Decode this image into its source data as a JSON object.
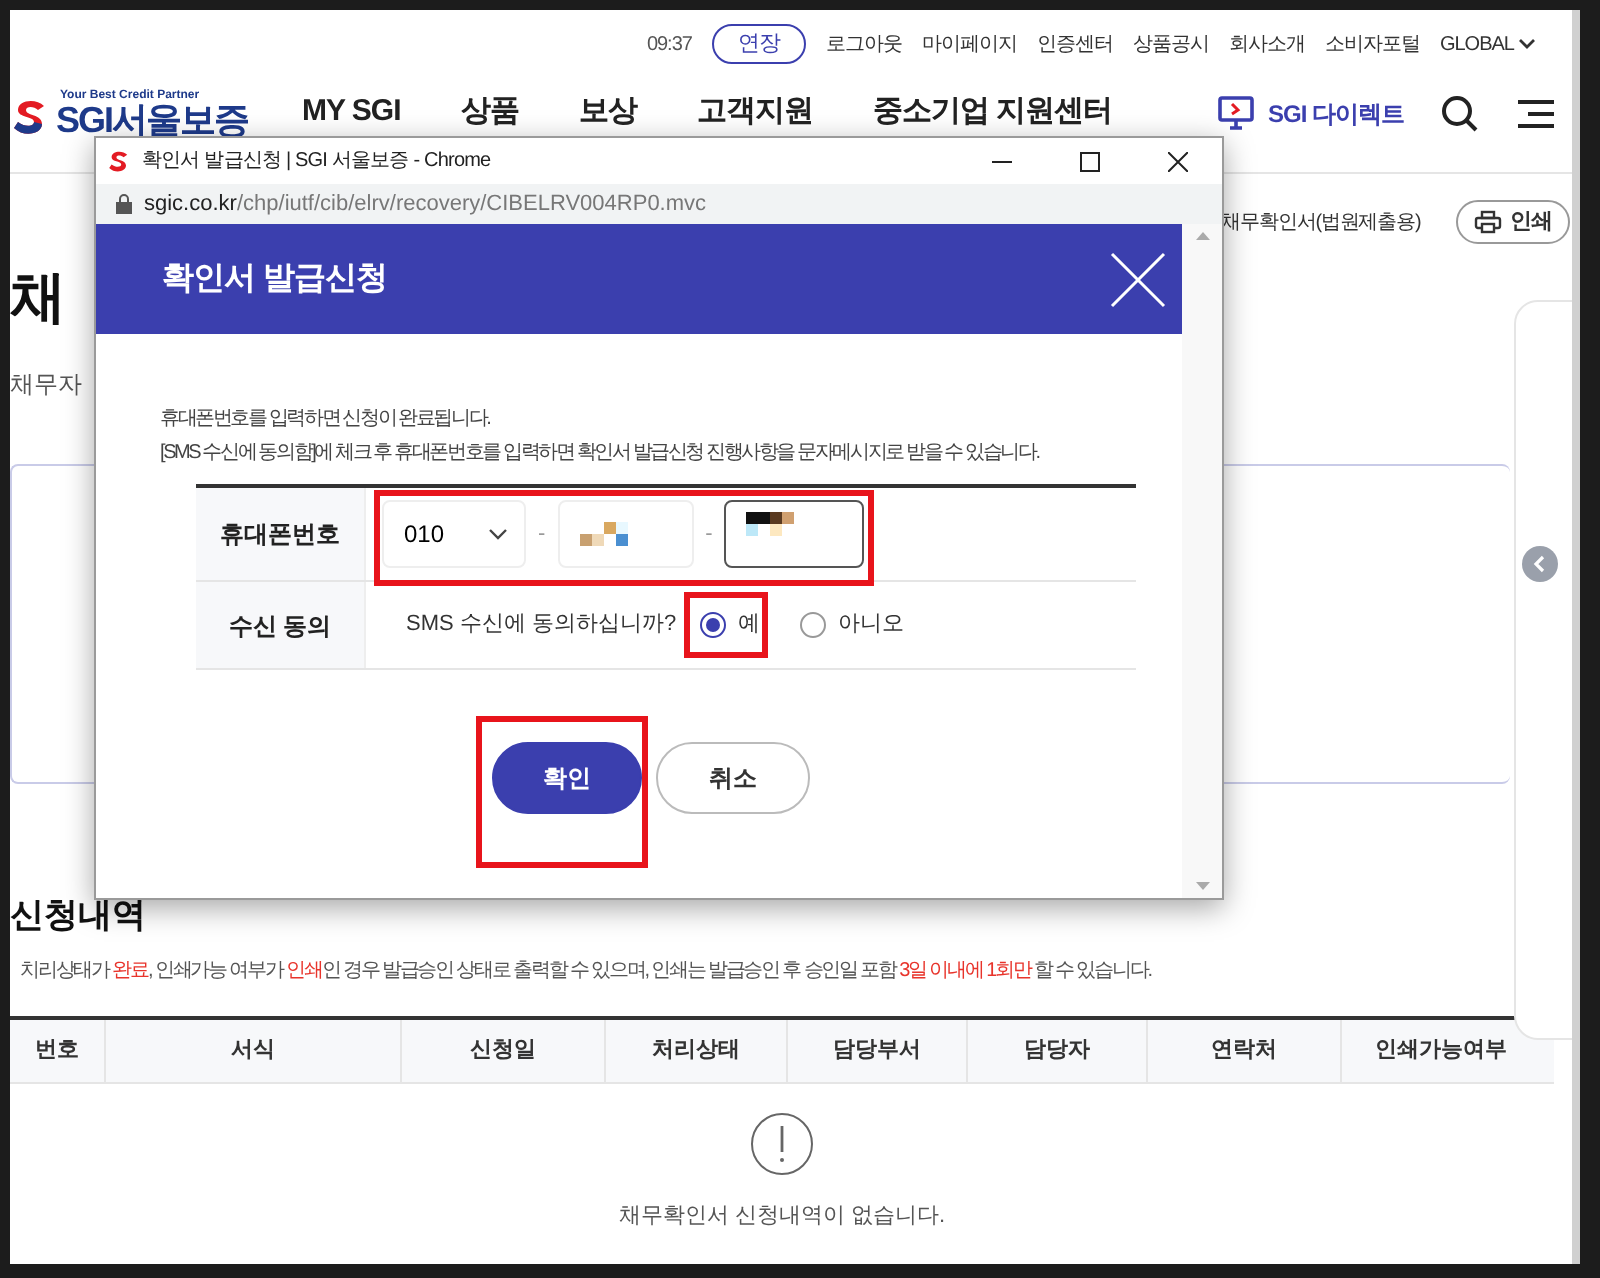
{
  "top_bar": {
    "time": "09:37",
    "extend_button": "연장",
    "links": [
      "로그아웃",
      "마이페이지",
      "인증센터",
      "상품공시",
      "회사소개",
      "소비자포털"
    ],
    "language": "GLOBAL"
  },
  "header": {
    "logo_tagline": "Your Best Credit Partner",
    "logo_text": "SGI서울보증",
    "nav": [
      "MY SGI",
      "상품",
      "보상",
      "고객지원",
      "중소기업 지원센터"
    ],
    "direct_link": "SGI 다이렉트"
  },
  "breadcrumb": [
    "채무확인서(법원제출용)"
  ],
  "print_button": "인쇄",
  "page_title": "채",
  "page_subtitle": "채무자",
  "history": {
    "title": "신청내역",
    "note_parts": [
      {
        "text": "치리상태가 ",
        "highlight": false
      },
      {
        "text": "완료",
        "highlight": true
      },
      {
        "text": ", 인쇄가능 여부가 ",
        "highlight": false
      },
      {
        "text": "인쇄",
        "highlight": true
      },
      {
        "text": "인 경우 발급승인 상태로 출력할 수 있으며, 인쇄는 발급승인 후 승인일 포함 ",
        "highlight": false
      },
      {
        "text": "3일 이내에 1회만",
        "highlight": true
      },
      {
        "text": " 할 수 있습니다.",
        "highlight": false
      }
    ],
    "columns": [
      "번호",
      "서식",
      "신청일",
      "처리상태",
      "담당부서",
      "담당자",
      "연락처",
      "인쇄가능여부"
    ],
    "empty_message": "채무확인서 신청내역이 없습니다."
  },
  "popup": {
    "window_title": "확인서 발급신청 | SGI 서울보증 - Chrome",
    "url_domain": "sgic.co.kr",
    "url_path": "/chp/iutf/cib/elrv/recovery/CIBELRV004RP0.mvc",
    "title": "확인서 발급신청",
    "notes": [
      "휴대폰번호를 입력하면 신청이 완료됩니다.",
      "[SMS 수신에 동의함]에 체크 후 휴대폰번호를 입력하면 확인서 발급신청 진행사항을 문자메시지로 받을 수 있습니다."
    ],
    "phone": {
      "label": "휴대폰번호",
      "prefix": "010",
      "separators": [
        "-",
        "-"
      ],
      "highlighted": true
    },
    "consent": {
      "label": "수신 동의",
      "question": "SMS 수신에 동의하십니까?",
      "options": [
        {
          "label": "예",
          "selected": true,
          "highlighted": true
        },
        {
          "label": "아니오",
          "selected": false,
          "highlighted": false
        }
      ]
    },
    "buttons": [
      {
        "label": "확인",
        "kind": "primary",
        "highlighted": true
      },
      {
        "label": "취소",
        "kind": "secondary",
        "highlighted": false
      }
    ]
  }
}
